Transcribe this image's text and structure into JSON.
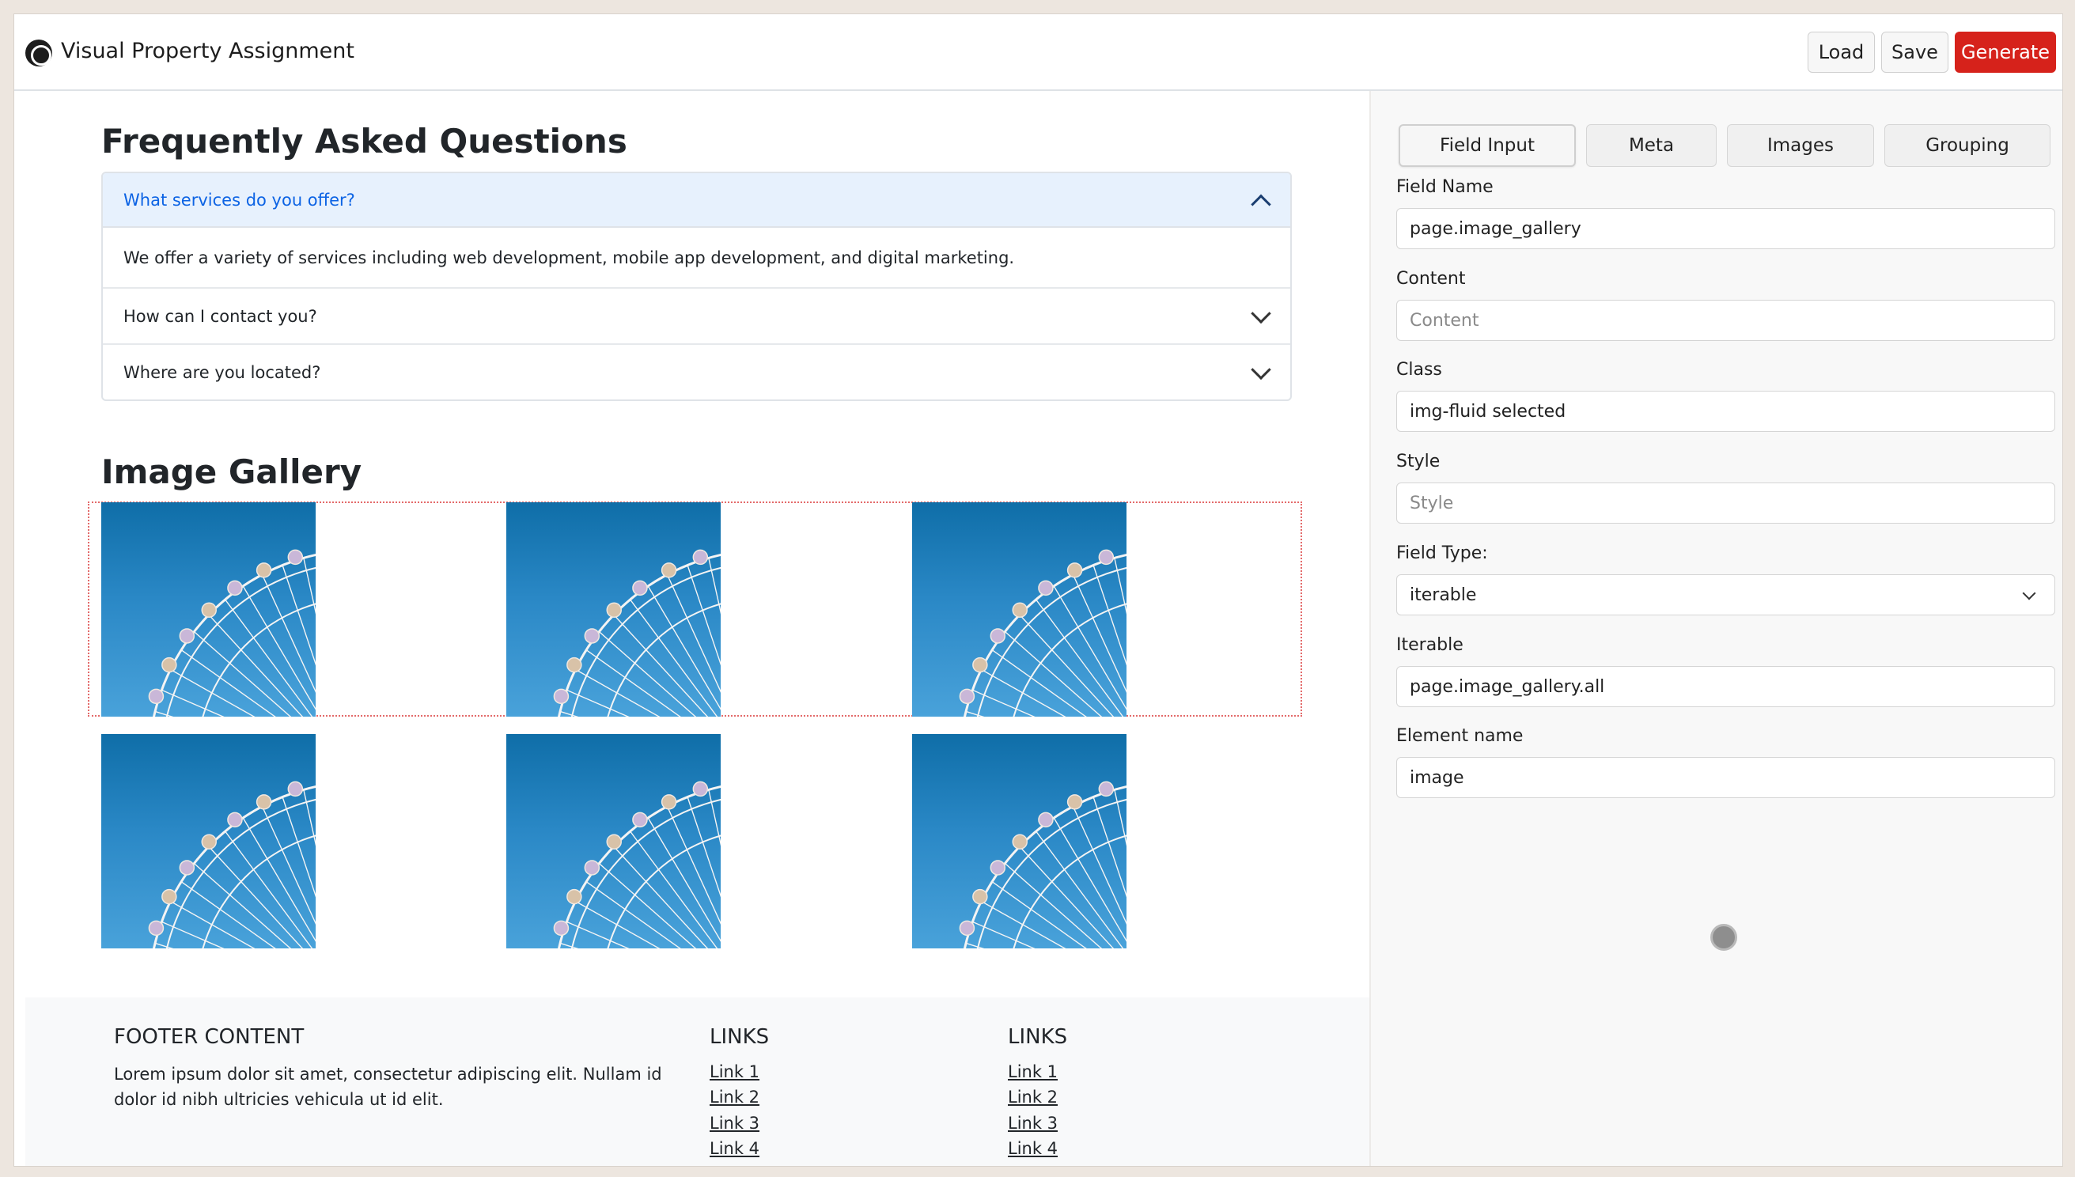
{
  "app": {
    "title": "Visual Property Assignment"
  },
  "header": {
    "load_label": "Load",
    "save_label": "Save",
    "generate_label": "Generate"
  },
  "faq": {
    "title": "Frequently Asked Questions",
    "items": [
      {
        "question": "What services do you offer?",
        "answer": "We offer a variety of services including web development, mobile app development, and digital marketing.",
        "open": true
      },
      {
        "question": "How can I contact you?",
        "open": false
      },
      {
        "question": "Where are you located?",
        "open": false
      }
    ]
  },
  "gallery": {
    "title": "Image Gallery",
    "image_count": 6
  },
  "footer": {
    "content_heading": "FOOTER CONTENT",
    "content_text": "Lorem ipsum dolor sit amet, consectetur adipiscing elit. Nullam id dolor id nibh ultricies vehicula ut id elit.",
    "links_heading_1": "LINKS",
    "links_heading_2": "LINKS",
    "links_1": [
      "Link 1",
      "Link 2",
      "Link 3",
      "Link 4"
    ],
    "links_2": [
      "Link 1",
      "Link 2",
      "Link 3",
      "Link 4"
    ]
  },
  "panel": {
    "tabs": [
      "Field Input",
      "Meta",
      "Images",
      "Grouping"
    ],
    "active_tab": "Field Input",
    "fields": {
      "field_name": {
        "label": "Field Name",
        "value": "page.image_gallery"
      },
      "content": {
        "label": "Content",
        "placeholder": "Content"
      },
      "class": {
        "label": "Class",
        "value": "img-fluid selected"
      },
      "style": {
        "label": "Style",
        "placeholder": "Style"
      },
      "field_type": {
        "label": "Field Type:",
        "value": "iterable"
      },
      "iterable": {
        "label": "Iterable",
        "value": "page.image_gallery.all"
      },
      "element_name": {
        "label": "Element name",
        "value": "image"
      }
    }
  },
  "colors": {
    "accent": "#d6221b",
    "accordion_active_bg": "#e7f1fd",
    "accordion_active_text": "#0c63e4",
    "selection_outline": "#e36a6a"
  }
}
